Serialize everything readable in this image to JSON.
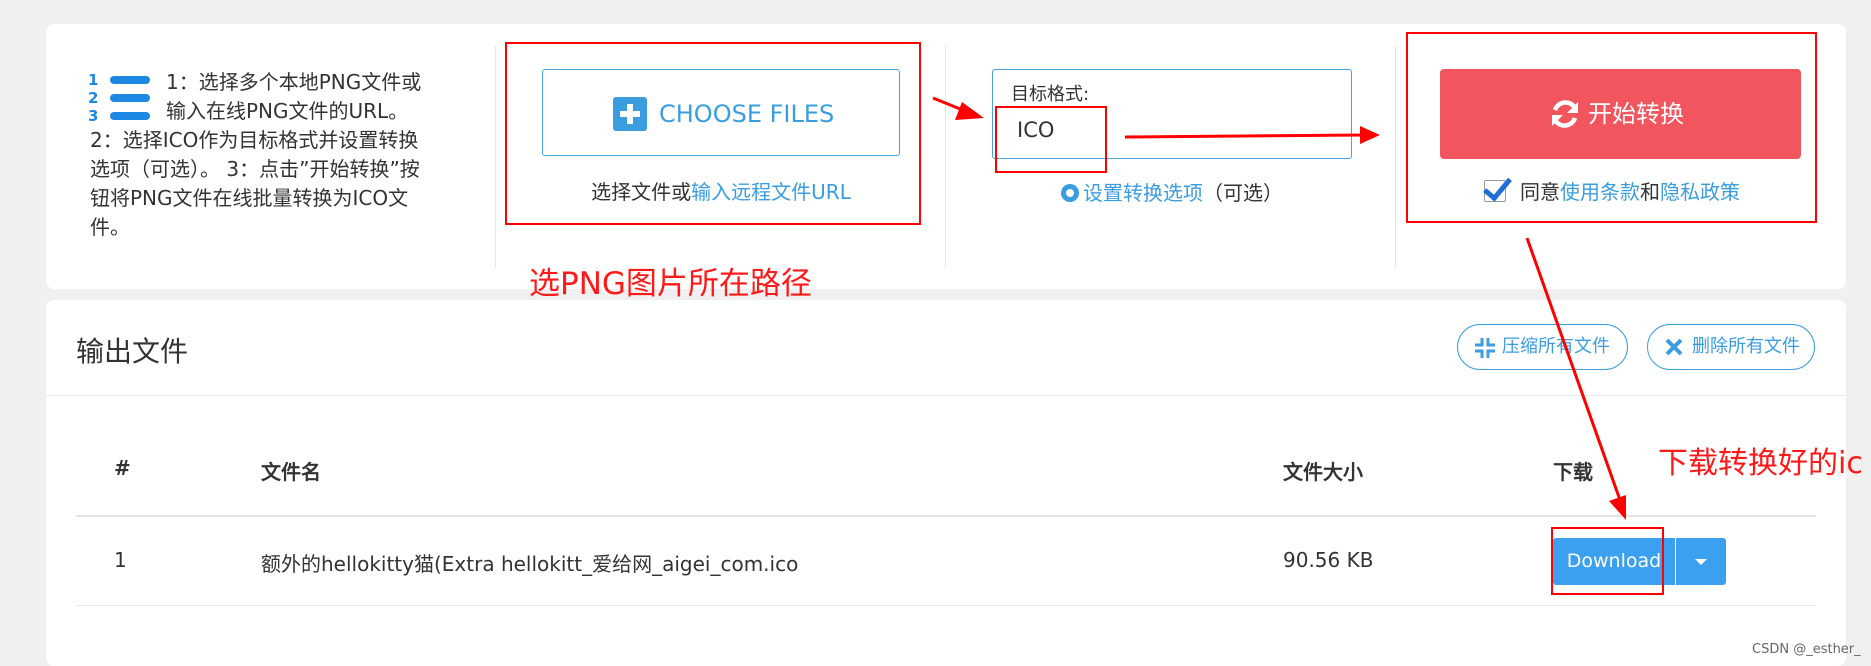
{
  "steps": {
    "icon_numbers": [
      "1",
      "2",
      "3"
    ],
    "lines": [
      "1：选择多个本地PNG文件或",
      "输入在线PNG文件的URL。",
      "2：选择ICO作为目标格式并设置转换",
      "选项（可选）。 3：点击”开始转换”按",
      "钮将PNG文件在线批量转换为ICO文",
      "件。"
    ]
  },
  "upload": {
    "button_label": "CHOOSE FILES",
    "sub_prefix": "选择文件或",
    "sub_link": "输入远程文件URL"
  },
  "format": {
    "label": "目标格式:",
    "value": "ICO",
    "settings_link": "设置转换选项",
    "settings_suffix": "（可选）"
  },
  "convert": {
    "button_label": "开始转换",
    "agree_prefix": "同意",
    "terms_link": "使用条款",
    "and": "和",
    "privacy_link": "隐私政策",
    "agreed": true
  },
  "output": {
    "title": "输出文件",
    "compress_all": "压缩所有文件",
    "delete_all": "删除所有文件",
    "columns": [
      "#",
      "文件名",
      "文件大小",
      "下载"
    ],
    "rows": [
      {
        "index": "1",
        "filename": "额外的hellokitty猫(Extra hellokitt_爱给网_aigei_com.ico",
        "size": "90.56 KB",
        "action": "Download"
      }
    ]
  },
  "annotations": {
    "path_note": "选PNG图片所在路径",
    "download_note": "下载转换好的ic"
  },
  "watermark": "CSDN @_esther_",
  "colors": {
    "accent": "#3a9de0",
    "convert": "#f1565e",
    "annotation": "#ff0000",
    "background": "#f0f0f0"
  },
  "icons": [
    "steps-list-icon",
    "plus-icon",
    "gear-icon",
    "refresh-icon",
    "check-icon",
    "compress-icon",
    "close-icon",
    "caret-down-icon"
  ]
}
